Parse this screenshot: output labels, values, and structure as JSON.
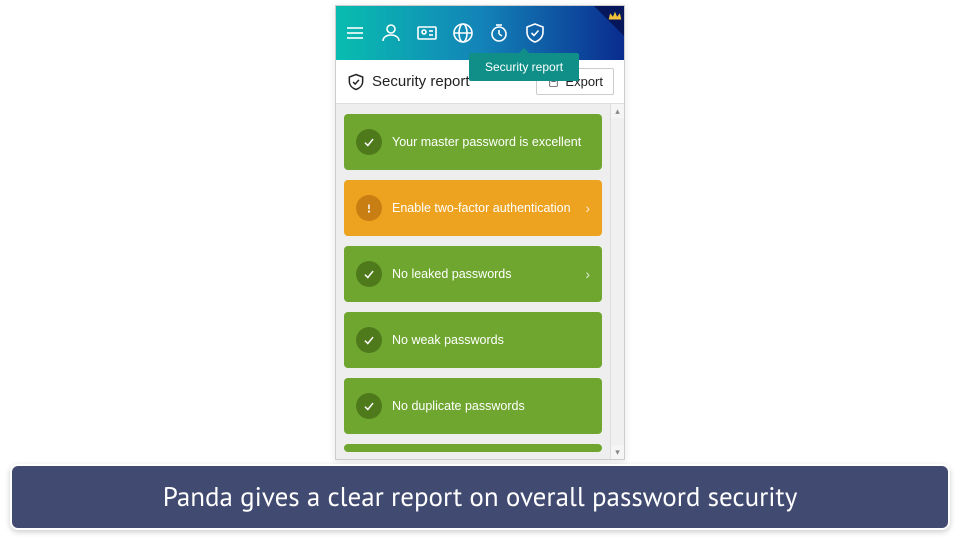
{
  "header": {
    "tooltip": "Security report"
  },
  "subheader": {
    "title": "Security report",
    "export_label": "Export"
  },
  "cards": [
    {
      "label": "Your master password is excellent",
      "status": "ok",
      "chevron": false
    },
    {
      "label": "Enable two-factor authentication",
      "status": "warn",
      "chevron": true
    },
    {
      "label": "No leaked passwords",
      "status": "ok",
      "chevron": true
    },
    {
      "label": "No weak passwords",
      "status": "ok",
      "chevron": false
    },
    {
      "label": "No duplicate passwords",
      "status": "ok",
      "chevron": false
    }
  ],
  "caption": "Panda gives a clear report on overall password security"
}
